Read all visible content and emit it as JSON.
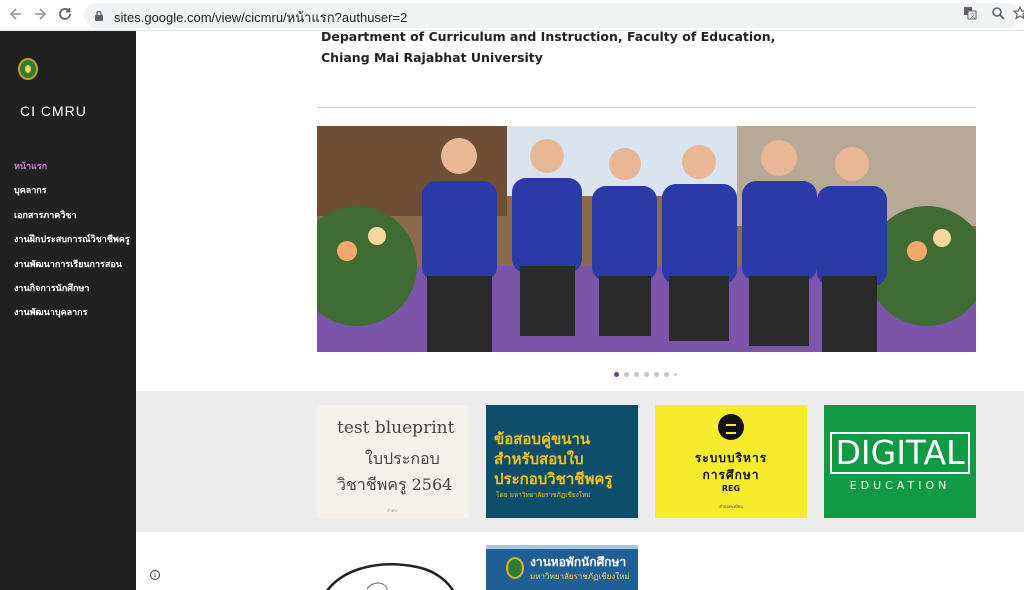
{
  "browser": {
    "url": "sites.google.com/view/cicmru/หน้าแรก?authuser=2",
    "back_icon": "arrow-left-icon",
    "forward_icon": "arrow-right-icon",
    "reload_icon": "reload-icon",
    "translate_icon": "translate-icon",
    "zoom_icon": "zoom-icon",
    "star_icon": "star-icon"
  },
  "sidebar": {
    "site_title": "CI CMRU",
    "items": [
      {
        "label": "หน้าแรก",
        "active": true
      },
      {
        "label": "บุคลากร",
        "active": false
      },
      {
        "label": "เอกสารภาควิชา",
        "active": false
      },
      {
        "label": "งานฝึกประสบการณ์วิชาชีพครู",
        "active": false
      },
      {
        "label": "งานพัฒนาการเรียนการสอน",
        "active": false
      },
      {
        "label": "งานกิจการนักศึกษา",
        "active": false
      },
      {
        "label": "งานพัฒนาบุคลากร",
        "active": false
      }
    ]
  },
  "main": {
    "heading_line1": "Department of Curriculum and Instruction, Faculty of Education,",
    "heading_line2": "Chiang Mai Rajabhat University",
    "carousel": {
      "slide_count": 7,
      "active_index": 0
    },
    "cards": [
      {
        "line1": "test blueprint",
        "line2": "ใบประกอบ",
        "line3": "วิชาชีพครู 2564",
        "small": "ลำดับ"
      },
      {
        "line1": "ข้อสอบคู่ขนาน",
        "line2": "สำหรับสอบใบ",
        "line3": "ประกอบวิชาชีพครู",
        "sub": "โดย มหาวิทยาลัยราชภัฏเชียงใหม่"
      },
      {
        "line1": "ระบบบริหาร",
        "line2": "การศึกษา",
        "line3": "REG",
        "small": "สำนักทะเบียน"
      },
      {
        "line1": "DIGITAL",
        "line2": "EDUCATION"
      }
    ],
    "bottom_card": {
      "title": "งานหอพักนักศึกษา",
      "subtitle": "มหาวิทยาลัยราชภัฏเชียงใหม่"
    }
  },
  "colors": {
    "sidebar_bg": "#212121",
    "active_nav": "#d47ad4",
    "card_reg": "#f6ec2c",
    "card_digital": "#0f9a43",
    "card_exam": "#0f4e6a"
  }
}
